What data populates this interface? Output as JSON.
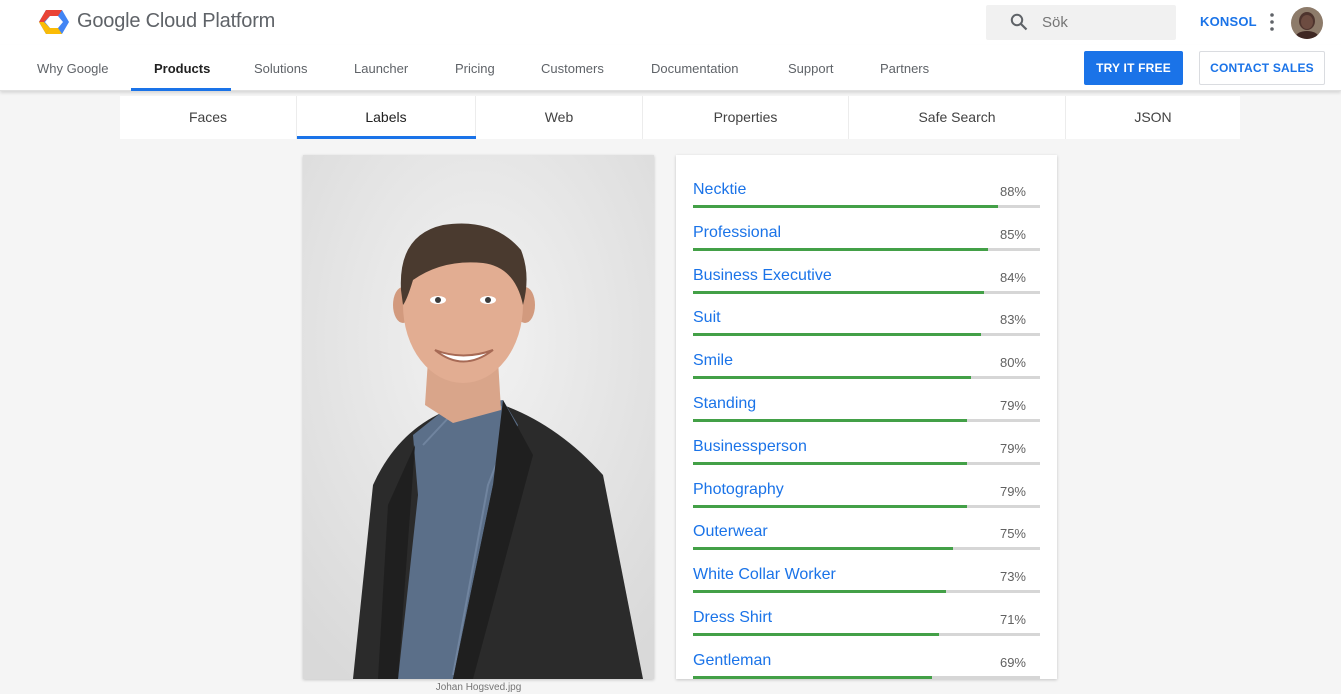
{
  "header": {
    "brand": "Google Cloud Platform",
    "search_placeholder": "Sök",
    "console_label": "KONSOL",
    "icons": [
      "google-cloud-logo",
      "search-icon",
      "more-vert-icon",
      "avatar"
    ]
  },
  "nav": {
    "items": [
      "Why Google",
      "Products",
      "Solutions",
      "Launcher",
      "Pricing",
      "Customers",
      "Documentation",
      "Support",
      "Partners"
    ],
    "active": "Products",
    "try_free": "TRY IT FREE",
    "contact_sales": "CONTACT SALES"
  },
  "subtabs": {
    "items": [
      "Faces",
      "Labels",
      "Web",
      "Properties",
      "Safe Search",
      "JSON"
    ],
    "active": "Labels"
  },
  "image": {
    "caption": "Johan Hogsved.jpg"
  },
  "labels": [
    {
      "name": "Necktie",
      "percent": "88%",
      "score": 0.88
    },
    {
      "name": "Professional",
      "percent": "85%",
      "score": 0.85
    },
    {
      "name": "Business Executive",
      "percent": "84%",
      "score": 0.84
    },
    {
      "name": "Suit",
      "percent": "83%",
      "score": 0.83
    },
    {
      "name": "Smile",
      "percent": "80%",
      "score": 0.8
    },
    {
      "name": "Standing",
      "percent": "79%",
      "score": 0.79
    },
    {
      "name": "Businessperson",
      "percent": "79%",
      "score": 0.79
    },
    {
      "name": "Photography",
      "percent": "79%",
      "score": 0.79
    },
    {
      "name": "Outerwear",
      "percent": "75%",
      "score": 0.75
    },
    {
      "name": "White Collar Worker",
      "percent": "73%",
      "score": 0.73
    },
    {
      "name": "Dress Shirt",
      "percent": "71%",
      "score": 0.71
    },
    {
      "name": "Gentleman",
      "percent": "69%",
      "score": 0.69
    }
  ],
  "colors": {
    "accent": "#1a73e8",
    "bar_fill": "#43a047",
    "bar_track": "#d6d6d6"
  }
}
